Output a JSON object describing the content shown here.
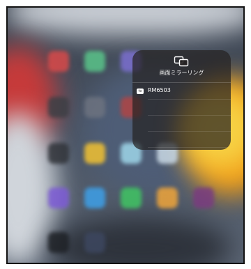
{
  "panel": {
    "title": "画面ミラーリング",
    "icon": "screen-mirroring-icon"
  },
  "devices": [
    {
      "name": "RM6503",
      "icon": "apple-tv-icon",
      "badge": "tv"
    }
  ],
  "colors": {
    "wallpaper_red": "#c63a3a",
    "wallpaper_orange": "#f3a019",
    "wallpaper_yellow": "#f6d144",
    "panel_bg": "#262222"
  }
}
